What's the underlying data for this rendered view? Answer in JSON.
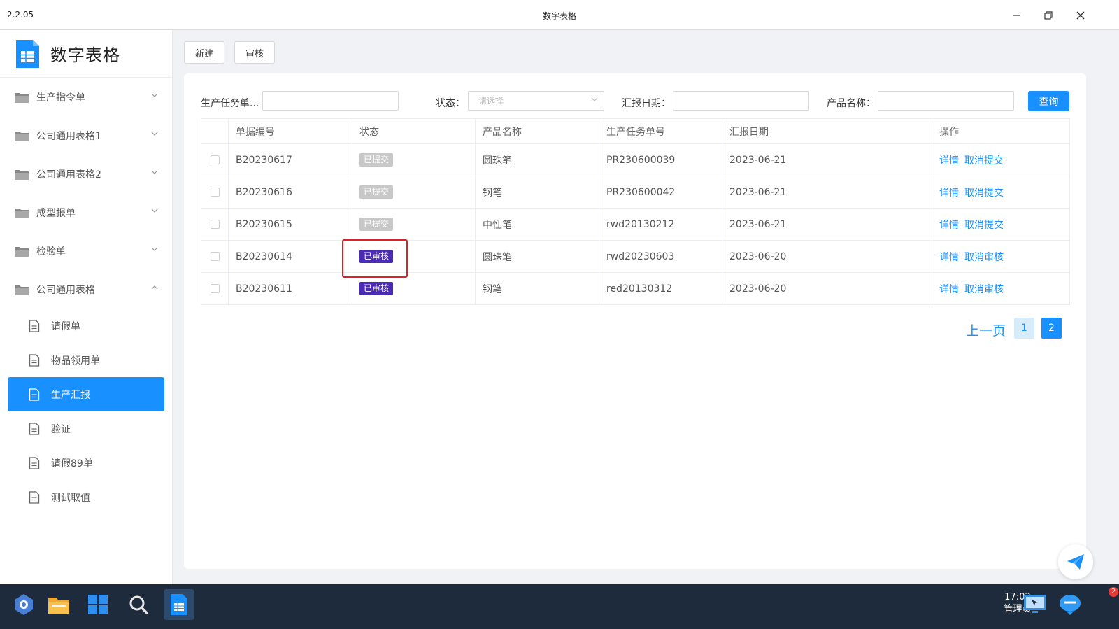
{
  "window": {
    "version": "2.2.05",
    "title": "数字表格"
  },
  "sidebar": {
    "brand": "数字表格",
    "groups": [
      {
        "label": "生产指令单"
      },
      {
        "label": "公司通用表格1"
      },
      {
        "label": "公司通用表格2"
      },
      {
        "label": "成型报单"
      },
      {
        "label": "检验单"
      },
      {
        "label": "公司通用表格"
      }
    ],
    "items": [
      {
        "label": "请假单"
      },
      {
        "label": "物品领用单"
      },
      {
        "label": "生产汇报"
      },
      {
        "label": "验证"
      },
      {
        "label": "请假89单"
      },
      {
        "label": "测试取值"
      }
    ],
    "active_item": "生产汇报"
  },
  "toolbar": {
    "new_label": "新建",
    "review_label": "审核"
  },
  "filters": {
    "task_no_label": "生产任务单...",
    "status_label": "状态：",
    "status_placeholder": "请选择",
    "date_label": "汇报日期：",
    "product_label": "产品名称：",
    "query_label": "查询"
  },
  "table": {
    "headers": [
      "单据编号",
      "状态",
      "产品名称",
      "生产任务单号",
      "汇报日期",
      "操作"
    ],
    "rows": [
      {
        "id": "B20230617",
        "status": "已提交",
        "product": "圆珠笔",
        "task": "PR230600039",
        "date": "2023-06-21",
        "op1": "详情",
        "op2": "取消提交"
      },
      {
        "id": "B20230616",
        "status": "已提交",
        "product": "钢笔",
        "task": "PR230600042",
        "date": "2023-06-21",
        "op1": "详情",
        "op2": "取消提交"
      },
      {
        "id": "B20230615",
        "status": "已提交",
        "product": "中性笔",
        "task": "rwd20130212",
        "date": "2023-06-21",
        "op1": "详情",
        "op2": "取消提交"
      },
      {
        "id": "B20230614",
        "status": "已审核",
        "product": "圆珠笔",
        "task": "rwd20230603",
        "date": "2023-06-20",
        "op1": "详情",
        "op2": "取消审核"
      },
      {
        "id": "B20230611",
        "status": "已审核",
        "product": "钢笔",
        "task": "red20130312",
        "date": "2023-06-20",
        "op1": "详情",
        "op2": "取消审核"
      }
    ]
  },
  "pagination": {
    "prev_label": "上一页",
    "pages": [
      "1",
      "2"
    ],
    "current": "2"
  },
  "taskbar": {
    "time": "17:02",
    "user": "管理员",
    "notification_count": "2"
  },
  "colors": {
    "primary": "#1890ff",
    "approved": "#4b2ab4",
    "submitted": "#c8c8c8",
    "highlight": "#e02020"
  },
  "icons": [
    "minimize-icon",
    "restore-icon",
    "close-icon",
    "folder-icon",
    "chevron-down-icon",
    "chevron-up-icon",
    "document-icon",
    "send-icon",
    "app-logo-icon"
  ]
}
